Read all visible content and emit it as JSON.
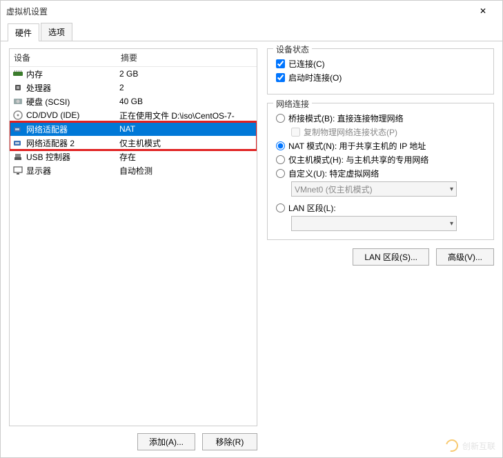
{
  "window": {
    "title": "虚拟机设置",
    "close_glyph": "✕"
  },
  "tabs": {
    "hardware": "硬件",
    "options": "选项"
  },
  "list": {
    "header_device": "设备",
    "header_summary": "摘要",
    "items": [
      {
        "icon": "memory",
        "label": "内存",
        "summary": "2 GB",
        "selected": false
      },
      {
        "icon": "cpu",
        "label": "处理器",
        "summary": "2",
        "selected": false
      },
      {
        "icon": "hdd",
        "label": "硬盘 (SCSI)",
        "summary": "40 GB",
        "selected": false
      },
      {
        "icon": "disc",
        "label": "CD/DVD (IDE)",
        "summary": "正在使用文件 D:\\iso\\CentOS-7-",
        "selected": false
      },
      {
        "icon": "net",
        "label": "网络适配器",
        "summary": "NAT",
        "selected": true
      },
      {
        "icon": "net",
        "label": "网络适配器 2",
        "summary": "仅主机模式",
        "selected": false
      },
      {
        "icon": "usb",
        "label": "USB 控制器",
        "summary": "存在",
        "selected": false
      },
      {
        "icon": "display",
        "label": "显示器",
        "summary": "自动检测",
        "selected": false
      }
    ]
  },
  "buttons": {
    "add": "添加(A)...",
    "remove": "移除(R)",
    "lan_segments": "LAN 区段(S)...",
    "advanced": "高级(V)..."
  },
  "device_status": {
    "title": "设备状态",
    "connected": "已连接(C)",
    "connect_at_poweron": "启动时连接(O)"
  },
  "network": {
    "title": "网络连接",
    "bridged": "桥接模式(B): 直接连接物理网络",
    "replicate": "复制物理网络连接状态(P)",
    "nat": "NAT 模式(N): 用于共享主机的 IP 地址",
    "hostonly": "仅主机模式(H): 与主机共享的专用网络",
    "custom": "自定义(U): 特定虚拟网络",
    "custom_select": "VMnet0 (仅主机模式)",
    "lan_segment": "LAN 区段(L):",
    "lan_select": ""
  },
  "watermark": "创新互联"
}
